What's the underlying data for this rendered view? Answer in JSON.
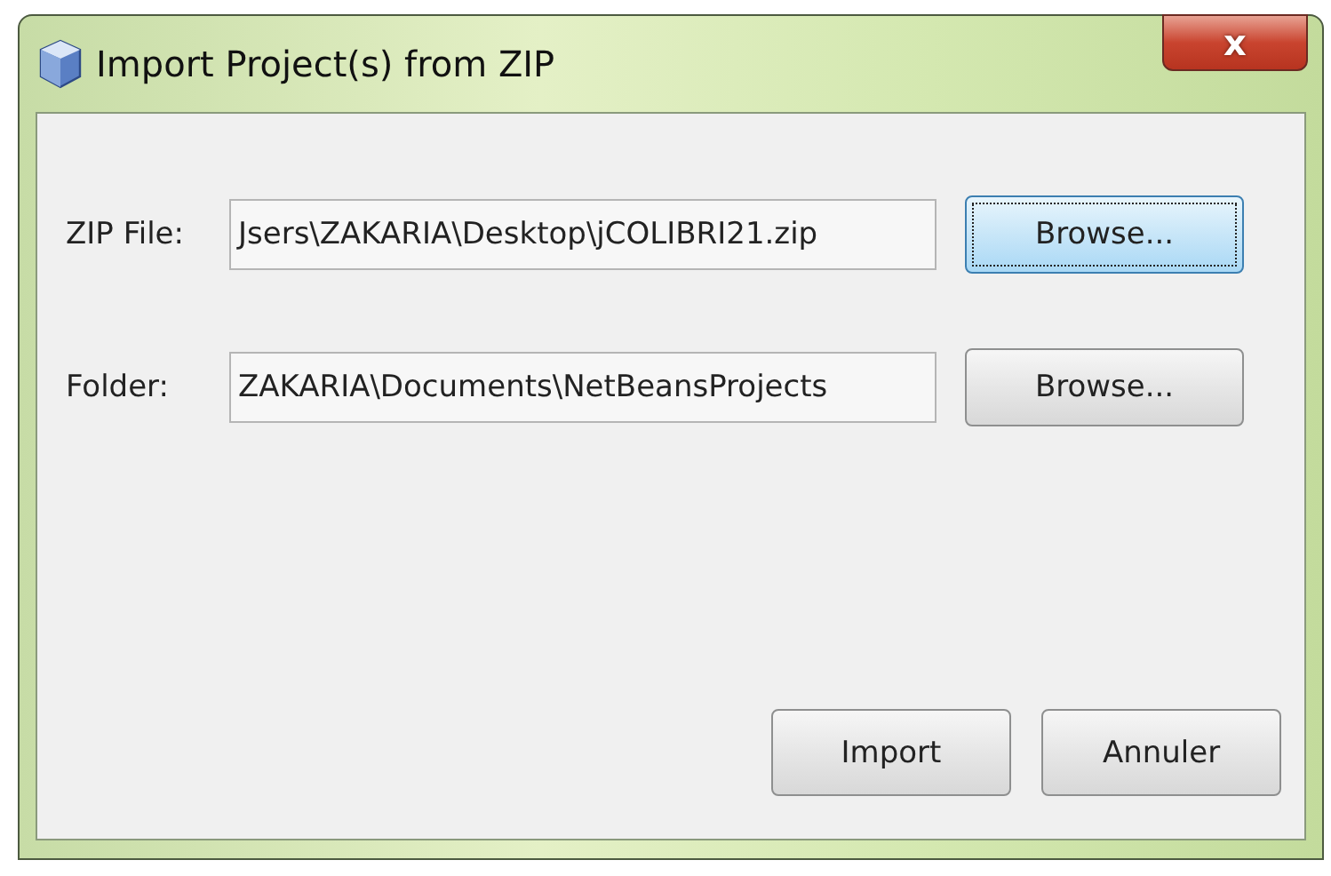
{
  "window": {
    "title": "Import Project(s) from ZIP",
    "close": "x"
  },
  "fields": [
    {
      "label": "ZIP File:",
      "value": "Jsers\\ZAKARIA\\Desktop\\jCOLIBRI21.zip",
      "button": {
        "label": "Browse...",
        "focused": true
      }
    },
    {
      "label": "Folder:",
      "value": "ZAKARIA\\Documents\\NetBeansProjects",
      "button": {
        "label": "Browse...",
        "focused": false
      }
    }
  ],
  "buttons": [
    {
      "label": "Import",
      "focused": false
    },
    {
      "label": "Annuler",
      "focused": false
    }
  ]
}
